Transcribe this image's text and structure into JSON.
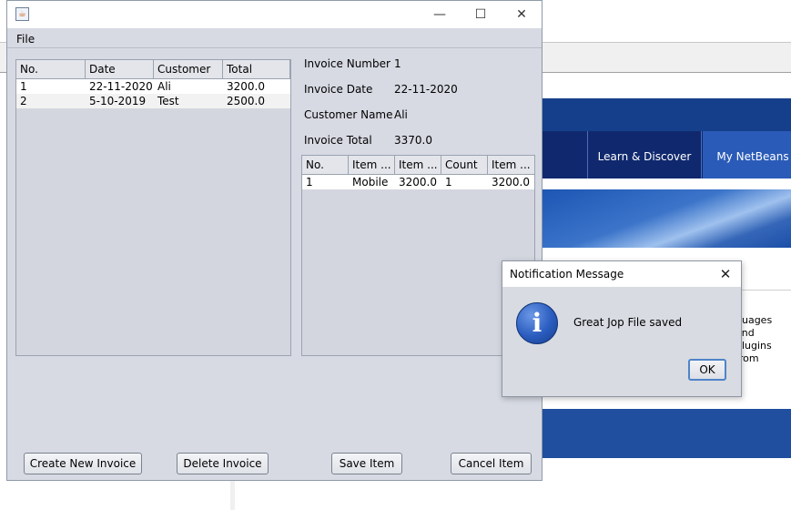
{
  "ide_background": {
    "nav_items": [
      "Learn & Discover",
      "My NetBeans"
    ],
    "partial_text": [
      "guages and",
      "plugins from"
    ]
  },
  "window": {
    "title": "",
    "icon": "java-cup-icon",
    "controls": {
      "minimize": "—",
      "maximize": "☐",
      "close": "✕"
    }
  },
  "menu": {
    "file": "File"
  },
  "invoices_table": {
    "headers": [
      "No.",
      "Date",
      "Customer",
      "Total"
    ],
    "rows": [
      [
        "1",
        "22-11-2020",
        "Ali",
        "3200.0"
      ],
      [
        "2",
        "5-10-2019",
        "Test",
        "2500.0"
      ]
    ]
  },
  "invoice_details": {
    "number_label": "Invoice Number",
    "number_value": "1",
    "date_label": "Invoice Date",
    "date_value": "22-11-2020",
    "customer_label": "Customer Name",
    "customer_value": "Ali",
    "total_label": "Invoice Total",
    "total_value": "3370.0"
  },
  "items_table": {
    "headers": [
      "No.",
      "Item ...",
      "Item ...",
      "Count",
      "Item ..."
    ],
    "rows": [
      [
        "1",
        "Mobile",
        "3200.0",
        "1",
        "3200.0"
      ]
    ]
  },
  "buttons": {
    "create": "Create New Invoice",
    "delete": "Delete Invoice",
    "save": "Save Item",
    "cancel": "Cancel Item"
  },
  "dialog": {
    "title": "Notification Message",
    "close": "✕",
    "icon": "info-icon",
    "icon_glyph": "i",
    "message": "Great Jop File saved",
    "ok": "OK"
  }
}
